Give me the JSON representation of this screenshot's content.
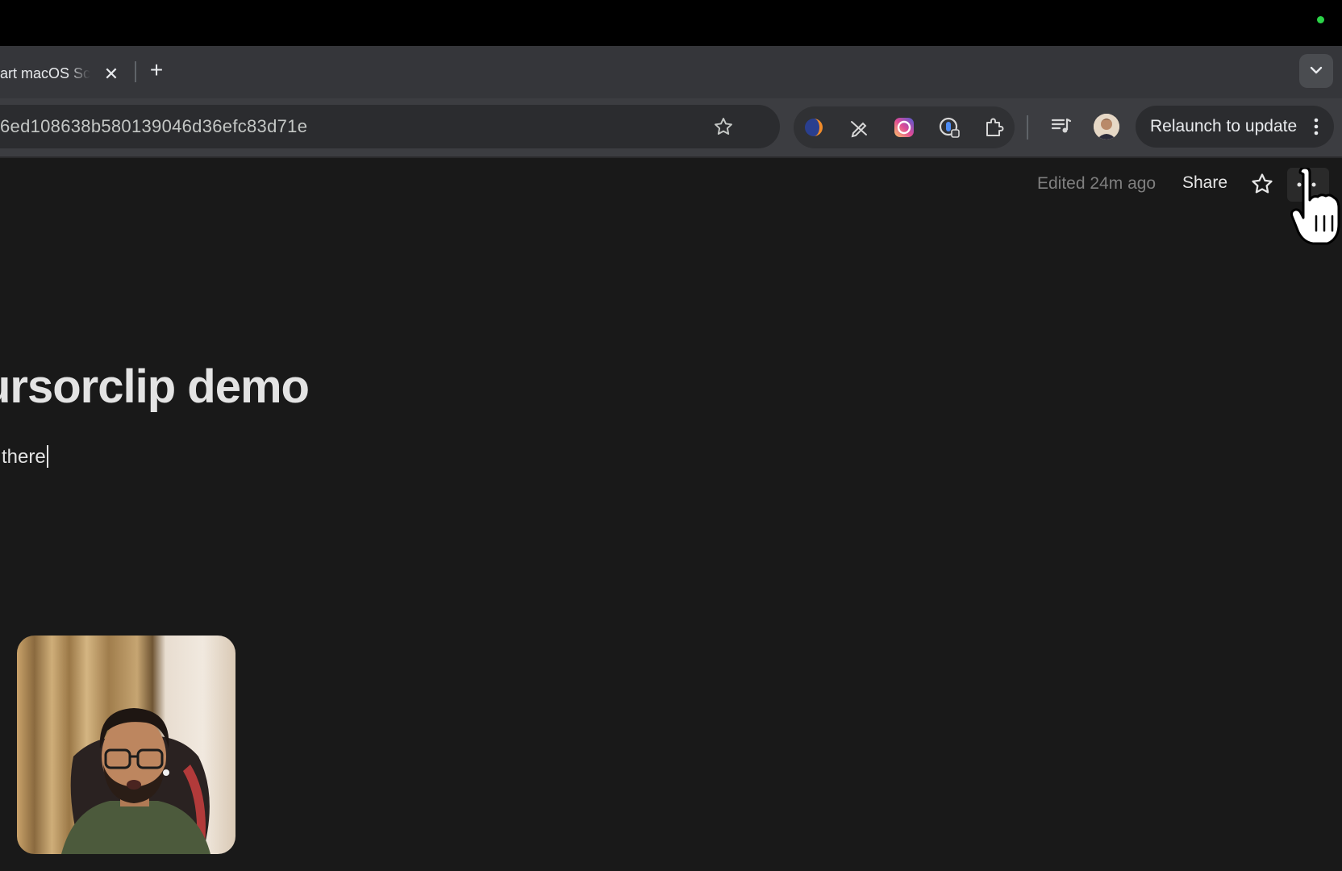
{
  "browser": {
    "tab": {
      "title": "art macOS Sc",
      "close_symbol": "✕"
    },
    "new_tab_symbol": "+",
    "omnibox": {
      "url": "6ed108638b580139046d36efc83d71e"
    },
    "extensions": [
      "arc-sphere-icon",
      "pen-slash-icon",
      "instagram-icon",
      "password-key-icon",
      "puzzle-icon"
    ],
    "relaunch_label": "Relaunch to update"
  },
  "notion": {
    "edited": "Edited 24m ago",
    "share_label": "Share",
    "title": "ursorclip demo",
    "body": "there"
  },
  "colors": {
    "page_bg": "#191919",
    "toolbar_bg": "#3c3d41",
    "tabstrip_bg": "#35363a",
    "mic_indicator": "#2bd348"
  }
}
